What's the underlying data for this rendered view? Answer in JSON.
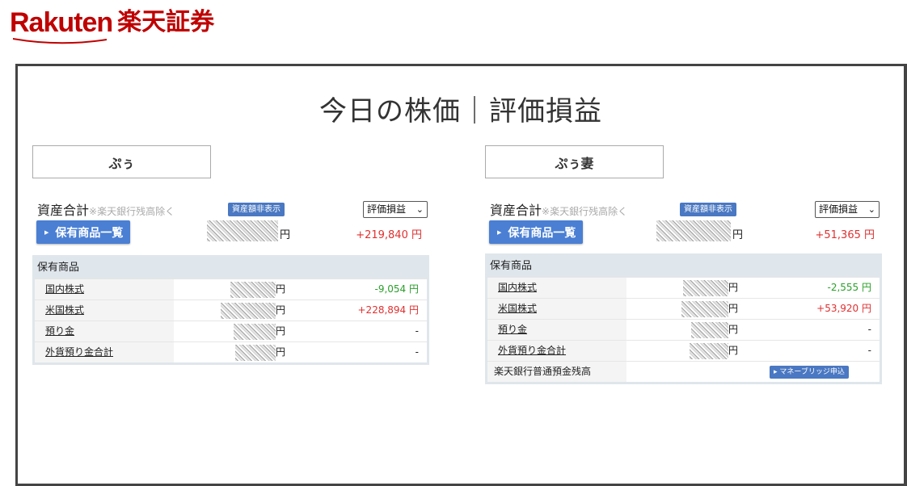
{
  "logo": {
    "text": "Rakuten",
    "jp": "楽天証券"
  },
  "page": {
    "title": "今日の株価｜評価損益"
  },
  "accounts": [
    {
      "name": "ぷぅ",
      "asset_label": "資産合計",
      "asset_note": "※楽天銀行残高除く",
      "hide_button": "資産額非表示",
      "select_value": "評価損益",
      "holdings_button": "保有商品一覧",
      "total_yen": "円",
      "total_pl": "+219,840 円",
      "table_header": "保有商品",
      "rows": [
        {
          "label": "国内株式",
          "yen": "円",
          "value": "-9,054 円"
        },
        {
          "label": "米国株式",
          "yen": "円",
          "value": "+228,894 円"
        },
        {
          "label": "預り金",
          "yen": "円",
          "value": "-"
        },
        {
          "label": "外貨預り金合計",
          "yen": "円",
          "value": "-"
        }
      ]
    },
    {
      "name": "ぷぅ妻",
      "asset_label": "資産合計",
      "asset_note": "※楽天銀行残高除く",
      "hide_button": "資産額非表示",
      "select_value": "評価損益",
      "holdings_button": "保有商品一覧",
      "total_yen": "円",
      "total_pl": "+51,365 円",
      "table_header": "保有商品",
      "rows": [
        {
          "label": "国内株式",
          "yen": "円",
          "value": "-2,555 円"
        },
        {
          "label": "米国株式",
          "yen": "円",
          "value": "+53,920 円"
        },
        {
          "label": "預り金",
          "yen": "円",
          "value": "-"
        },
        {
          "label": "外貨預り金合計",
          "yen": "円",
          "value": "-"
        }
      ],
      "bank": {
        "label": "楽天銀行普通預金残高",
        "button": "マネーブリッジ申込"
      }
    }
  ],
  "colors": {
    "brand": "#bf0000",
    "button": "#4a7fd4",
    "positive": "#e03030",
    "negative": "#2aa02a"
  }
}
